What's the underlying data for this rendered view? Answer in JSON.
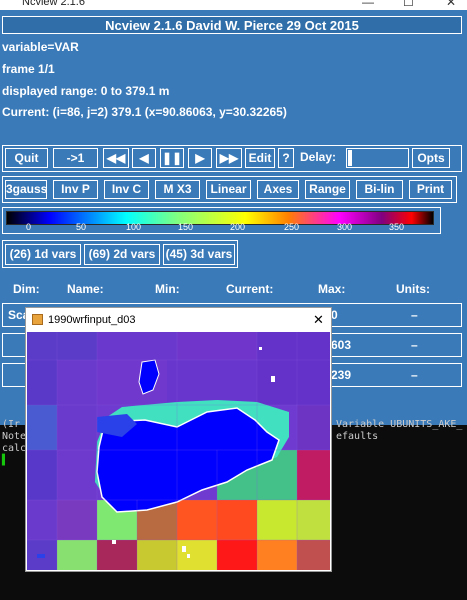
{
  "window": {
    "title": "Ncview 2.1.6",
    "min": "—",
    "max": "☐",
    "close": "✕"
  },
  "banner": "Ncview 2.1.6 David W. Pierce  29 Oct 2015",
  "info": {
    "variable": "variable=VAR",
    "frame": "frame 1/1",
    "range": "displayed range: 0 to 379.1 m",
    "current": "Current: (i=86, j=2) 379.1 (x=90.86063, y=30.32265)"
  },
  "toolbar1": {
    "quit": "Quit",
    "step": "->1",
    "rewind": "◀◀",
    "back": "◀",
    "pause": "❚❚",
    "fwd": "▶",
    "ffwd": "▶▶",
    "edit": "Edit",
    "help": "?",
    "delay_label": "Delay:",
    "opts": "Opts"
  },
  "toolbar2": [
    "3gauss",
    "Inv P",
    "Inv C",
    "M X3",
    "Linear",
    "Axes",
    "Range",
    "Bi-lin",
    "Print"
  ],
  "colorbar_ticks": [
    "0",
    "50",
    "100",
    "150",
    "200",
    "250",
    "300",
    "350"
  ],
  "var_buttons": [
    "(26) 1d vars",
    "(69) 2d vars",
    "(45) 3d vars"
  ],
  "table": {
    "headers": [
      "Dim:",
      "Name:",
      "Min:",
      "Current:",
      "Max:",
      "Units:"
    ],
    "rows": [
      {
        "dim": "Sca",
        "max": "0",
        "units": "–"
      },
      {
        "dim": "",
        "max": "603",
        "units": "–"
      },
      {
        "dim": "",
        "max": "239",
        "units": "–"
      }
    ]
  },
  "terminal": {
    "lines": [
      "(Ir",
      "Note",
      "calc"
    ],
    "right_lines": [
      "Variable UBUNITS_AKE_",
      "efaults"
    ],
    "cursor": "▌"
  },
  "child_window": {
    "title": "1990wrfinput_d03",
    "close": "✕"
  },
  "colors": {
    "panel": "#3a7ab8",
    "lake": "#0000ff",
    "border": "#ffffff"
  }
}
